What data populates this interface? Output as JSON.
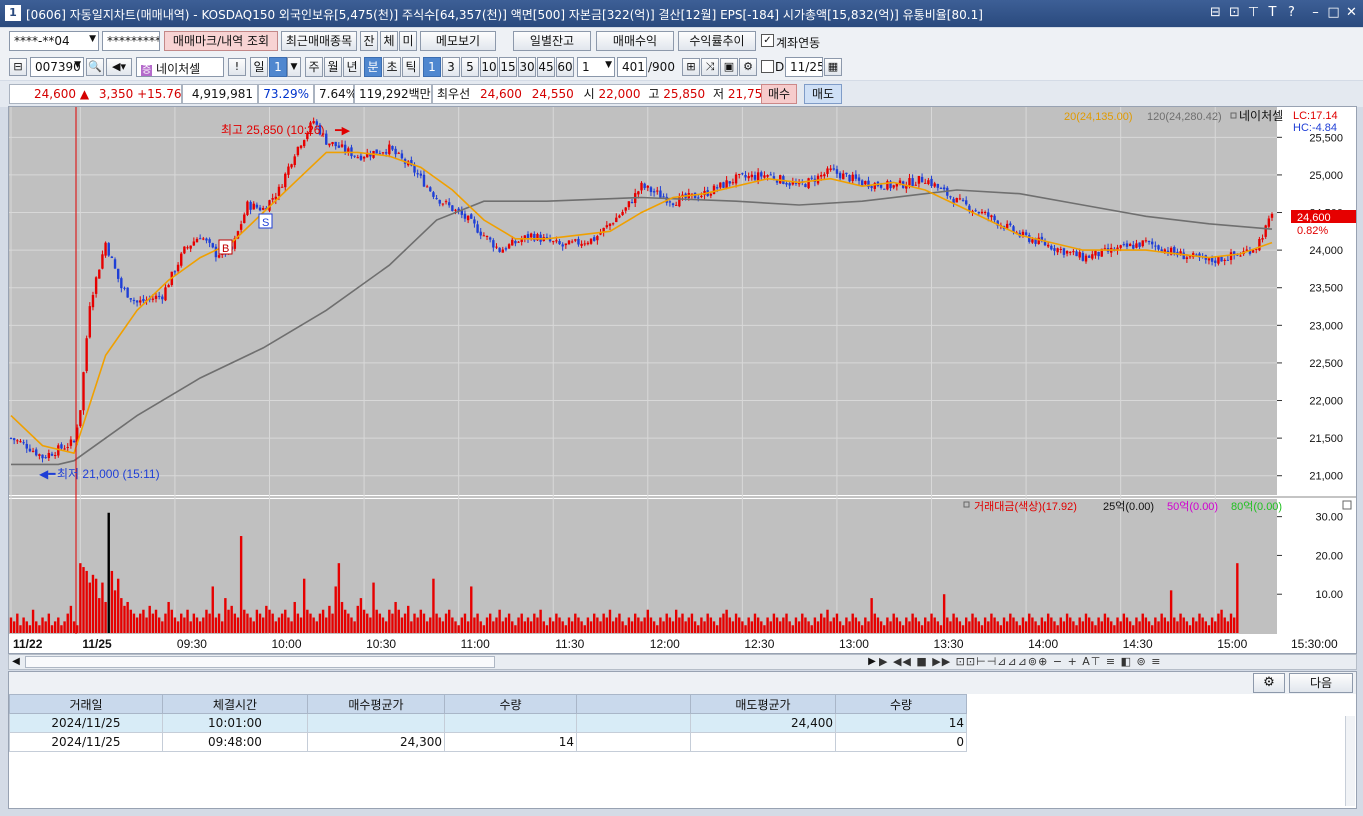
{
  "window": {
    "number": "1",
    "title": "[0606] 자동일지차트(매매내역) - KOSDAQ150 외국인보유[5,475(천)] 주식수[64,357(천)] 액면[500] 자본금[322(억)] 결산[12월] EPS[-184] 시가총액[15,832(억)] 유통비율[80.1]",
    "controls": [
      "⊟",
      "⊡",
      "⊤",
      "T",
      "?",
      "–",
      "□",
      "✕"
    ]
  },
  "toolbar1": {
    "account": "****-**04",
    "password": "*********",
    "trade_mark_btn": "매매마크/내역 조회",
    "recent_btn": "최근매매종목",
    "jan": "잔",
    "che": "체",
    "mi": "미",
    "memo_btn": "메모보기",
    "daily_balance_btn": "일별잔고",
    "trade_profit_btn": "매매수익",
    "return_trend_btn": "수익률추이",
    "account_link_label": "계좌연동"
  },
  "toolbar2": {
    "code": "007390",
    "stock_name": "네이처셀",
    "period_day": "일",
    "period_day_num": "1",
    "period_week": "주",
    "period_month": "월",
    "period_year": "년",
    "period_min": "분",
    "period_sec": "초",
    "period_tick": "틱",
    "intervals": [
      "1",
      "3",
      "5",
      "10",
      "15",
      "30",
      "45",
      "60"
    ],
    "interval_custom": "1",
    "count": "401",
    "count_max": "/900",
    "d_label": "D",
    "date": "11/25"
  },
  "quote": {
    "price": "24,600",
    "arrow": "▲",
    "change": "3,350",
    "change_pct": "+15.76%",
    "volume": "4,919,981",
    "vol_ratio": "73.29%",
    "turnover": "7.64%",
    "amount": "119,292백만",
    "best_label": "최우선",
    "best_ask": "24,600",
    "best_bid": "24,550",
    "open_label": "시",
    "open": "22,000",
    "high_label": "고",
    "high": "25,850",
    "low_label": "저",
    "low": "21,750",
    "buy_btn": "매수",
    "sell_btn": "매도"
  },
  "chart_data": {
    "type": "candlestick",
    "legend_ma20": "20(24,135.00)",
    "legend_ma120": "120(24,280.42)",
    "legend_name": "네이처셀",
    "lc": "LC:17.14",
    "hc": "HC:-4.84",
    "current_price_tag": "24,600",
    "current_pct_tag": "0.82%",
    "high_annotation": "최고 25,850 (10:26)",
    "low_annotation": "최저 21,000 (15:11)",
    "buy_mark": "B",
    "sell_mark": "S",
    "ylim": [
      20850,
      25850
    ],
    "y_ticks": [
      "25,500",
      "25,000",
      "24,500",
      "24,000",
      "23,500",
      "23,000",
      "22,500",
      "22,000",
      "21,500",
      "21,000"
    ],
    "y_tick_values": [
      25500,
      25000,
      24500,
      24000,
      23500,
      23000,
      22500,
      22000,
      21500,
      21000
    ],
    "volume_legend": {
      "main": "거래대금(색상)(17.92)",
      "l25": "25억(0.00)",
      "l50": "50억(0.00)",
      "l80": "80억(0.00)"
    },
    "volume_ticks": [
      "30.00",
      "20.00",
      "10.00"
    ],
    "volume_tick_values": [
      30,
      20,
      10
    ],
    "x_labels": [
      "11/22",
      "11/25",
      "09:30",
      "10:00",
      "10:30",
      "11:00",
      "11:30",
      "12:00",
      "12:30",
      "13:00",
      "13:30",
      "14:00",
      "14:30",
      "15:00",
      "15:30:00"
    ],
    "price_path": [
      [
        0,
        21500
      ],
      [
        5,
        21400
      ],
      [
        10,
        21250
      ],
      [
        15,
        21350
      ],
      [
        20,
        21450
      ],
      [
        22,
        21900
      ],
      [
        25,
        23300
      ],
      [
        30,
        24100
      ],
      [
        35,
        23500
      ],
      [
        40,
        23300
      ],
      [
        48,
        23400
      ],
      [
        55,
        24000
      ],
      [
        60,
        24200
      ],
      [
        65,
        23950
      ],
      [
        70,
        24000
      ],
      [
        75,
        24600
      ],
      [
        80,
        24550
      ],
      [
        85,
        24800
      ],
      [
        90,
        25300
      ],
      [
        96,
        25720
      ],
      [
        100,
        25450
      ],
      [
        110,
        25250
      ],
      [
        120,
        25350
      ],
      [
        128,
        25050
      ],
      [
        135,
        24700
      ],
      [
        145,
        24400
      ],
      [
        155,
        24000
      ],
      [
        165,
        24200
      ],
      [
        175,
        24050
      ],
      [
        185,
        24150
      ],
      [
        195,
        24550
      ],
      [
        200,
        24850
      ],
      [
        210,
        24650
      ],
      [
        220,
        24750
      ],
      [
        230,
        24950
      ],
      [
        240,
        25000
      ],
      [
        250,
        24850
      ],
      [
        260,
        25050
      ],
      [
        270,
        24900
      ],
      [
        280,
        24850
      ],
      [
        290,
        24950
      ],
      [
        300,
        24650
      ],
      [
        310,
        24450
      ],
      [
        320,
        24200
      ],
      [
        330,
        24050
      ],
      [
        340,
        23900
      ],
      [
        350,
        24000
      ],
      [
        360,
        24100
      ],
      [
        370,
        23950
      ],
      [
        380,
        23850
      ],
      [
        390,
        23950
      ],
      [
        395,
        24050
      ],
      [
        400,
        24450
      ]
    ],
    "ma20_path": [
      [
        0,
        21800
      ],
      [
        10,
        21400
      ],
      [
        20,
        21300
      ],
      [
        30,
        22600
      ],
      [
        40,
        23200
      ],
      [
        50,
        23600
      ],
      [
        60,
        23900
      ],
      [
        70,
        24100
      ],
      [
        80,
        24500
      ],
      [
        90,
        24900
      ],
      [
        100,
        25300
      ],
      [
        110,
        25300
      ],
      [
        120,
        25250
      ],
      [
        130,
        25100
      ],
      [
        140,
        24800
      ],
      [
        150,
        24400
      ],
      [
        160,
        24150
      ],
      [
        170,
        24150
      ],
      [
        180,
        24200
      ],
      [
        190,
        24250
      ],
      [
        200,
        24500
      ],
      [
        210,
        24700
      ],
      [
        220,
        24750
      ],
      [
        230,
        24850
      ],
      [
        240,
        24950
      ],
      [
        250,
        24900
      ],
      [
        260,
        24950
      ],
      [
        270,
        24850
      ],
      [
        280,
        24900
      ],
      [
        290,
        24800
      ],
      [
        300,
        24600
      ],
      [
        310,
        24400
      ],
      [
        320,
        24200
      ],
      [
        330,
        24100
      ],
      [
        340,
        24000
      ],
      [
        350,
        24000
      ],
      [
        360,
        24000
      ],
      [
        370,
        23950
      ],
      [
        380,
        23900
      ],
      [
        390,
        23950
      ],
      [
        400,
        24100
      ]
    ],
    "ma120_path": [
      [
        0,
        21150
      ],
      [
        15,
        21150
      ],
      [
        20,
        21200
      ],
      [
        40,
        21800
      ],
      [
        60,
        22300
      ],
      [
        80,
        22700
      ],
      [
        100,
        23200
      ],
      [
        120,
        23800
      ],
      [
        135,
        24400
      ],
      [
        150,
        24650
      ],
      [
        170,
        24650
      ],
      [
        200,
        24700
      ],
      [
        230,
        24650
      ],
      [
        250,
        24600
      ],
      [
        270,
        24650
      ],
      [
        290,
        24750
      ],
      [
        300,
        24800
      ],
      [
        320,
        24750
      ],
      [
        340,
        24600
      ],
      [
        360,
        24450
      ],
      [
        380,
        24350
      ],
      [
        400,
        24280
      ]
    ],
    "volume_bars": [
      4,
      3,
      5,
      2,
      4,
      3,
      2,
      6,
      3,
      2,
      4,
      3,
      5,
      2,
      3,
      4,
      2,
      3,
      5,
      7,
      3,
      2,
      18,
      17,
      16,
      13,
      15,
      14,
      9,
      13,
      8,
      31,
      16,
      11,
      14,
      9,
      7,
      8,
      6,
      5,
      4,
      5,
      6,
      4,
      7,
      5,
      6,
      4,
      3,
      5,
      8,
      6,
      4,
      3,
      5,
      4,
      6,
      3,
      5,
      4,
      3,
      4,
      6,
      5,
      12,
      4,
      5,
      3,
      9,
      6,
      7,
      5,
      4,
      25,
      6,
      5,
      4,
      3,
      6,
      5,
      4,
      7,
      6,
      5,
      3,
      4,
      5,
      6,
      4,
      3,
      8,
      5,
      4,
      14,
      6,
      5,
      4,
      3,
      5,
      6,
      4,
      7,
      5,
      12,
      18,
      8,
      6,
      5,
      4,
      3,
      7,
      9,
      6,
      5,
      4,
      13,
      6,
      5,
      4,
      3,
      6,
      5,
      8,
      6,
      4,
      5,
      7,
      3,
      5,
      4,
      6,
      5,
      3,
      4,
      14,
      5,
      4,
      3,
      5,
      6,
      4,
      3,
      2,
      4,
      5,
      3,
      12,
      4,
      5,
      3,
      2,
      4,
      5,
      3,
      4,
      6,
      3,
      4,
      5,
      3,
      2,
      4,
      5,
      3,
      4,
      3,
      5,
      4,
      6,
      3,
      2,
      4,
      3,
      5,
      4,
      3,
      2,
      4,
      3,
      5,
      4,
      3,
      2,
      4,
      3,
      5,
      4,
      3,
      5,
      4,
      6,
      3,
      4,
      5,
      3,
      2,
      4,
      3,
      5,
      4,
      3,
      4,
      6,
      4,
      3,
      2,
      4,
      3,
      5,
      4,
      3,
      6,
      4,
      5,
      3,
      4,
      5,
      3,
      2,
      4,
      3,
      5,
      4,
      3,
      2,
      4,
      5,
      6,
      4,
      3,
      5,
      4,
      3,
      2,
      4,
      3,
      5,
      4,
      3,
      2,
      4,
      3,
      5,
      4,
      3,
      4,
      5,
      3,
      2,
      4,
      3,
      5,
      4,
      3,
      2,
      4,
      3,
      5,
      4,
      6,
      3,
      4,
      5,
      3,
      2,
      4,
      3,
      5,
      4,
      3,
      2,
      4,
      3,
      9,
      5,
      4,
      3,
      2,
      4,
      3,
      5,
      4,
      3,
      2,
      4,
      3,
      5,
      4,
      3,
      2,
      4,
      3,
      5,
      4,
      3,
      2,
      10,
      4,
      3,
      5,
      4,
      3,
      2,
      4,
      3,
      5,
      4,
      3,
      2,
      4,
      3,
      5,
      4,
      3,
      2,
      4,
      3,
      5,
      4,
      3,
      2,
      4,
      3,
      5,
      4,
      3,
      2,
      4,
      3,
      5,
      4,
      3,
      2,
      4,
      3,
      5,
      4,
      3,
      2,
      4,
      3,
      5,
      4,
      3,
      2,
      4,
      3,
      5,
      4,
      3,
      2,
      4,
      3,
      5,
      4,
      3,
      2,
      4,
      3,
      5,
      4,
      3,
      2,
      4,
      3,
      5,
      4,
      3,
      11,
      4,
      3,
      5,
      4,
      3,
      2,
      4,
      3,
      5,
      4,
      3,
      2,
      4,
      3,
      5,
      6,
      4,
      3,
      5,
      4,
      18
    ]
  },
  "toolstrip": {
    "left_arrow": "◀",
    "right_arrow": "▶",
    "icons": "▶ ◀◀ ■ ▶▶  ⊡⊡⊢⊣⊿⊿⊿⊚⊕ − + A⊤ ≡ ◧ ⊚ ≡"
  },
  "trades": {
    "next_btn": "다음",
    "columns": [
      "거래일",
      "체결시간",
      "매수평균가",
      "수량",
      "",
      "매도평균가",
      "수량"
    ],
    "rows": [
      {
        "date": "2024/11/25",
        "time": "10:01:00",
        "buy_avg": "",
        "buy_qty": "",
        "blank": "",
        "sell_avg": "24,400",
        "sell_qty": "14"
      },
      {
        "date": "2024/11/25",
        "time": "09:48:00",
        "buy_avg": "24,300",
        "buy_qty": "14",
        "blank": "",
        "sell_avg": "",
        "sell_qty": "0"
      }
    ]
  },
  "colors": {
    "up": "#e60000",
    "down": "#1f3fd6",
    "ma20": "#f0a000",
    "ma120": "#6f6f6f",
    "chart_bg": "#c0c0c0",
    "volume": "#e60000"
  }
}
